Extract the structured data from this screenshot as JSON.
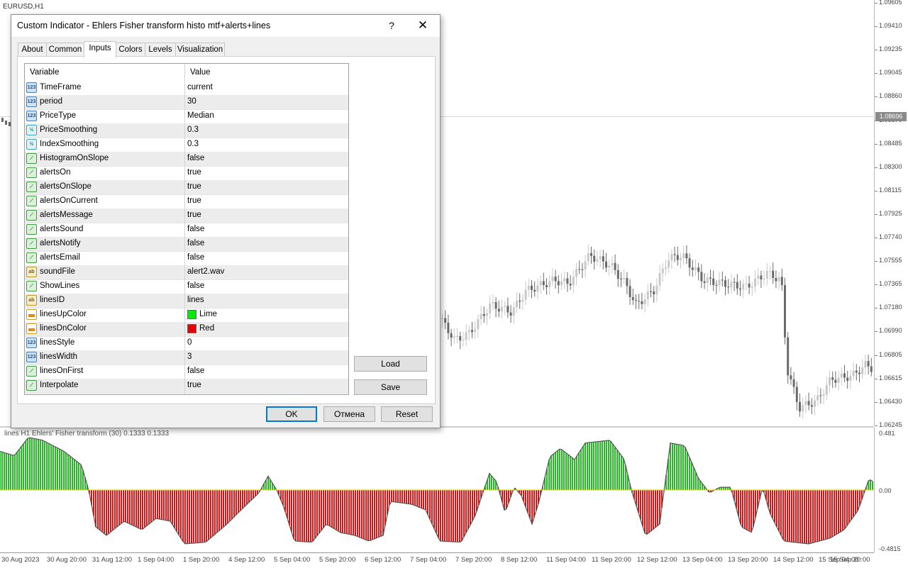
{
  "chart": {
    "symbol": "EURUSD,H1",
    "current_price": "1.08696",
    "price_ticks": [
      "1.09605",
      "1.09410",
      "1.09235",
      "1.09045",
      "1.08860",
      "1.08670",
      "1.08485",
      "1.08300",
      "1.08115",
      "1.07925",
      "1.07740",
      "1.07555",
      "1.07365",
      "1.07180",
      "1.06990",
      "1.06805",
      "1.06615",
      "1.06430",
      "1.06245"
    ],
    "indicator_title": "lines H1 Ehlers' Fisher transform (30) 0.1333 0.1333",
    "indicator_ticks": [
      "0.481",
      "0.00",
      "-0.4815"
    ],
    "time_ticks": [
      "30 Aug 2023",
      "30 Aug 20:00",
      "31 Aug 12:00",
      "1 Sep 04:00",
      "1 Sep 20:00",
      "4 Sep 12:00",
      "5 Sep 04:00",
      "5 Sep 20:00",
      "6 Sep 12:00",
      "7 Sep 04:00",
      "7 Sep 20:00",
      "8 Sep 12:00",
      "11 Sep 04:00",
      "11 Sep 20:00",
      "12 Sep 12:00",
      "13 Sep 04:00",
      "13 Sep 20:00",
      "14 Sep 12:00",
      "15 Sep 04:00",
      "15 Sep 20:00"
    ],
    "colors": {
      "up": "#22bb22",
      "down": "#dd1111",
      "candle_up": "#c8c8c8",
      "candle_down": "#6a6a6a"
    }
  },
  "dialog": {
    "title": "Custom Indicator - Ehlers Fisher transform histo mtf+alerts+lines",
    "help_label": "?",
    "close_label": "✕",
    "tabs": [
      {
        "label": "About",
        "active": false
      },
      {
        "label": "Common",
        "active": false
      },
      {
        "label": "Inputs",
        "active": true
      },
      {
        "label": "Colors",
        "active": false
      },
      {
        "label": "Levels",
        "active": false
      },
      {
        "label": "Visualization",
        "active": false
      }
    ],
    "grid": {
      "col_variable": "Variable",
      "col_value": "Value",
      "rows": [
        {
          "icon": "number-icon",
          "badge": "123",
          "name": "TimeFrame",
          "value": "current"
        },
        {
          "icon": "number-icon",
          "badge": "123",
          "name": "period",
          "value": "30"
        },
        {
          "icon": "number-icon",
          "badge": "123",
          "name": "PriceType",
          "value": "Median"
        },
        {
          "icon": "double-icon",
          "badge": "½",
          "name": "PriceSmoothing",
          "value": "0.3"
        },
        {
          "icon": "double-icon",
          "badge": "½",
          "name": "IndexSmoothing",
          "value": "0.3"
        },
        {
          "icon": "bool-icon",
          "badge": "⟋",
          "name": "HistogramOnSlope",
          "value": "false"
        },
        {
          "icon": "bool-icon",
          "badge": "⟋",
          "name": "alertsOn",
          "value": "true"
        },
        {
          "icon": "bool-icon",
          "badge": "⟋",
          "name": "alertsOnSlope",
          "value": "true"
        },
        {
          "icon": "bool-icon",
          "badge": "⟋",
          "name": "alertsOnCurrent",
          "value": "true"
        },
        {
          "icon": "bool-icon",
          "badge": "⟋",
          "name": "alertsMessage",
          "value": "true"
        },
        {
          "icon": "bool-icon",
          "badge": "⟋",
          "name": "alertsSound",
          "value": "false"
        },
        {
          "icon": "bool-icon",
          "badge": "⟋",
          "name": "alertsNotify",
          "value": "false"
        },
        {
          "icon": "bool-icon",
          "badge": "⟋",
          "name": "alertsEmail",
          "value": "false"
        },
        {
          "icon": "string-icon",
          "badge": "ab",
          "name": "soundFile",
          "value": "alert2.wav"
        },
        {
          "icon": "bool-icon",
          "badge": "⟋",
          "name": "ShowLines",
          "value": "false"
        },
        {
          "icon": "string-icon",
          "badge": "ab",
          "name": "linesID",
          "value": "lines"
        },
        {
          "icon": "color-icon",
          "badge": "",
          "name": "linesUpColor",
          "value": "Lime",
          "swatch": "#00ee00"
        },
        {
          "icon": "color-icon",
          "badge": "",
          "name": "linesDnColor",
          "value": "Red",
          "swatch": "#ee0000"
        },
        {
          "icon": "number-icon",
          "badge": "123",
          "name": "linesStyle",
          "value": "0"
        },
        {
          "icon": "number-icon",
          "badge": "123",
          "name": "linesWidth",
          "value": "3"
        },
        {
          "icon": "bool-icon",
          "badge": "⟋",
          "name": "linesOnFirst",
          "value": "false"
        },
        {
          "icon": "bool-icon",
          "badge": "⟋",
          "name": "Interpolate",
          "value": "true"
        }
      ]
    },
    "load_label": "Load",
    "save_label": "Save",
    "ok_label": "OK",
    "cancel_label": "Отмена",
    "reset_label": "Reset"
  }
}
